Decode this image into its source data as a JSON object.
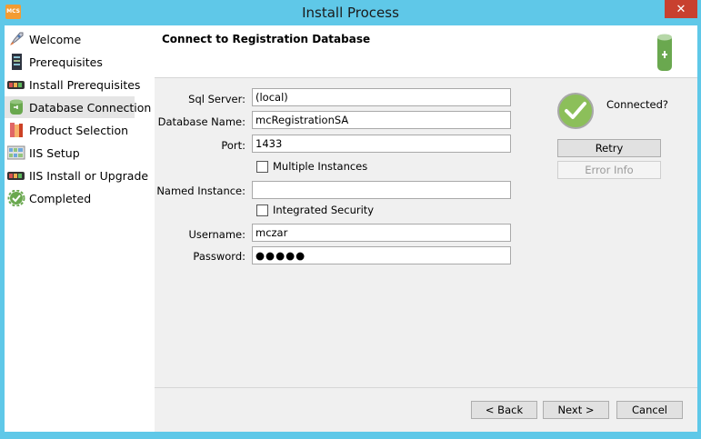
{
  "window": {
    "title": "Install Process",
    "app_icon_text": "MCS",
    "close_symbol": "✕"
  },
  "sidebar": {
    "items": [
      {
        "label": "Welcome",
        "icon": "rocket-icon",
        "active": false
      },
      {
        "label": "Prerequisites",
        "icon": "checklist-icon",
        "active": false
      },
      {
        "label": "Install Prerequisites",
        "icon": "battery-icon",
        "active": false
      },
      {
        "label": "Database Connection",
        "icon": "database-icon",
        "active": true
      },
      {
        "label": "Product Selection",
        "icon": "books-icon",
        "active": false
      },
      {
        "label": "IIS Setup",
        "icon": "web-grid-icon",
        "active": false
      },
      {
        "label": "IIS Install or Upgrade",
        "icon": "battery-icon",
        "active": false
      },
      {
        "label": "Completed",
        "icon": "gear-check-icon",
        "active": false
      }
    ]
  },
  "header": {
    "title": "Connect to Registration Database",
    "icon": "database-plug-icon"
  },
  "form": {
    "sql_server": {
      "label": "Sql Server:",
      "value": "(local)"
    },
    "database_name": {
      "label": "Database Name:",
      "value": "mcRegistrationSA"
    },
    "port": {
      "label": "Port:",
      "value": "1433"
    },
    "multiple_instances": {
      "label": "Multiple Instances",
      "checked": false
    },
    "named_instance": {
      "label": "Named Instance:",
      "value": ""
    },
    "integrated_security": {
      "label": "Integrated Security",
      "checked": false
    },
    "username": {
      "label": "Username:",
      "value": "mczar"
    },
    "password": {
      "label": "Password:",
      "value": "●●●●●"
    }
  },
  "status": {
    "text": "Connected?",
    "icon": "checkmark-circle-icon",
    "color": "#8cbf5a"
  },
  "buttons": {
    "retry": "Retry",
    "error_info": "Error Info",
    "back": "< Back",
    "next": "Next >",
    "cancel": "Cancel"
  }
}
